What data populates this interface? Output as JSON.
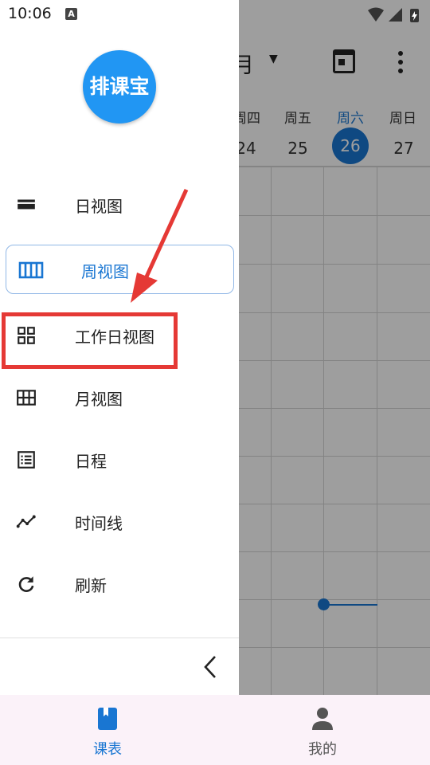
{
  "status_bar": {
    "time": "10:06",
    "notification_icon": "A"
  },
  "background": {
    "month": "月",
    "weekdays": [
      "周四",
      "周五",
      "周六",
      "周日"
    ],
    "dates": [
      "24",
      "25",
      "26",
      "27"
    ],
    "active_index": 2
  },
  "drawer": {
    "logo_text": "排课宝",
    "items": [
      {
        "label": "日视图",
        "icon": "day-view-icon"
      },
      {
        "label": "周视图",
        "icon": "week-view-icon"
      },
      {
        "label": "工作日视图",
        "icon": "work-day-view-icon"
      },
      {
        "label": "月视图",
        "icon": "month-view-icon"
      },
      {
        "label": "日程",
        "icon": "schedule-icon"
      },
      {
        "label": "时间线",
        "icon": "timeline-icon"
      },
      {
        "label": "刷新",
        "icon": "refresh-icon"
      }
    ],
    "selected_index": 1
  },
  "bottom_nav": {
    "tabs": [
      {
        "label": "课表",
        "icon": "bookmark-book-icon"
      },
      {
        "label": "我的",
        "icon": "person-icon"
      }
    ],
    "active_index": 0
  },
  "colors": {
    "accent": "#1976d2",
    "highlight": "#e53935",
    "logo": "#2196f3"
  }
}
